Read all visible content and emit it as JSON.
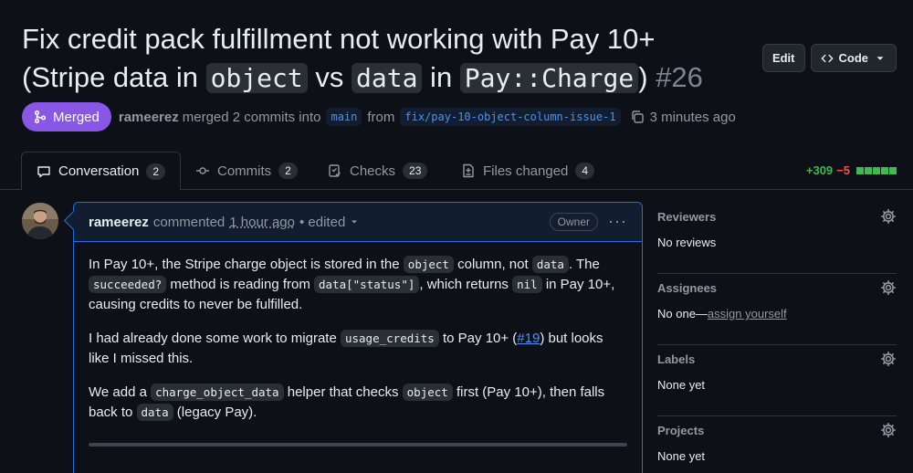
{
  "pr": {
    "title_part1": "Fix credit pack fulfillment not working with Pay 10+",
    "title_open": "(Stripe data in ",
    "title_code1": "object",
    "title_mid1": " vs ",
    "title_code2": "data",
    "title_mid2": " in ",
    "title_code3": "Pay::Charge",
    "title_close": ")",
    "number": "#26",
    "status": "Merged",
    "author": "rameerez",
    "merge_text": "merged 2 commits into",
    "base_branch": "main",
    "from_text": "from",
    "head_branch": "fix/pay-10-object-column-issue-1",
    "time": "3 minutes ago"
  },
  "header_buttons": {
    "edit": "Edit",
    "code": "Code"
  },
  "tabs": [
    {
      "label": "Conversation",
      "count": "2"
    },
    {
      "label": "Commits",
      "count": "2"
    },
    {
      "label": "Checks",
      "count": "23"
    },
    {
      "label": "Files changed",
      "count": "4"
    }
  ],
  "diffstat": {
    "additions": "+309",
    "deletions": "−5"
  },
  "comment": {
    "author": "rameerez",
    "action": "commented",
    "time": "1 hour ago",
    "edited": "• edited",
    "role": "Owner",
    "p1": [
      "In Pay 10+, the Stripe charge object is stored in the ",
      "object",
      " column, not ",
      "data",
      ". The ",
      "succeeded?",
      " method is reading from ",
      "data[\"status\"]",
      ", which returns ",
      "nil",
      " in Pay 10+, causing credits to never be fulfilled."
    ],
    "p2": [
      "I had already done some work to migrate ",
      "usage_credits",
      " to Pay 10+ (",
      "#19",
      ") but looks like I missed this."
    ],
    "p3": [
      "We add a ",
      "charge_object_data",
      " helper that checks ",
      "object",
      " first (Pay 10+), then falls back to ",
      "data",
      " (legacy Pay)."
    ]
  },
  "sidebar": {
    "reviewers": {
      "title": "Reviewers",
      "value": "No reviews"
    },
    "assignees": {
      "title": "Assignees",
      "value": "No one—",
      "link": "assign yourself"
    },
    "labels": {
      "title": "Labels",
      "value": "None yet"
    },
    "projects": {
      "title": "Projects",
      "value": "None yet"
    }
  },
  "colors": {
    "merged": "#8957e5",
    "accent": "#4493f8",
    "added": "#3fb950",
    "deleted": "#f85149"
  }
}
